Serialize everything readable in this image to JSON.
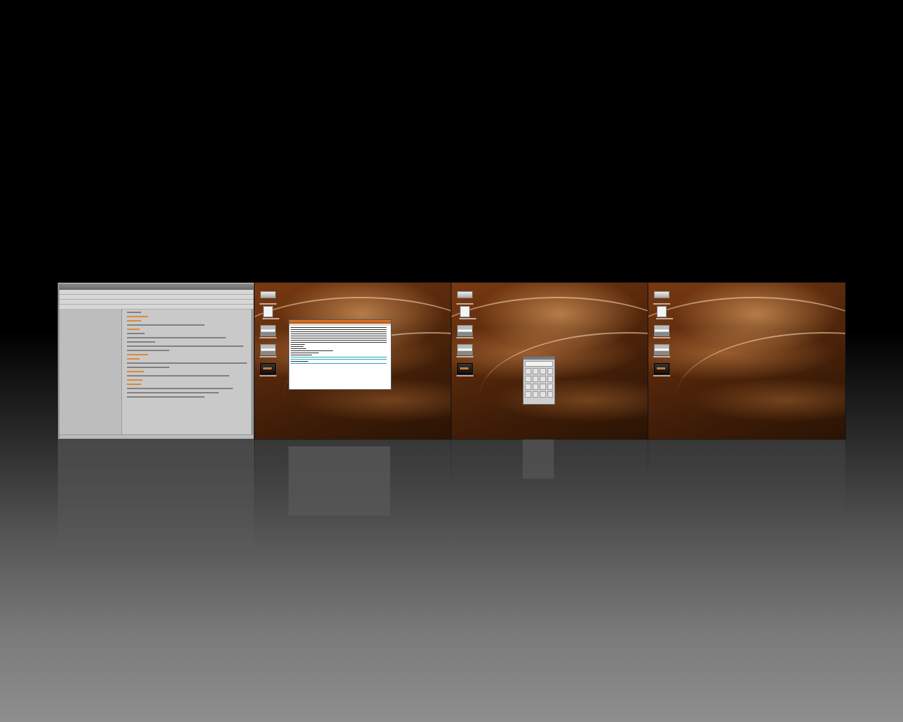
{
  "desktop": {
    "workspaces": [
      {
        "id": 1,
        "active": true,
        "window": "web-browser"
      },
      {
        "id": 2,
        "active": false,
        "window": "terminal"
      },
      {
        "id": 3,
        "active": false,
        "window": "calculator"
      },
      {
        "id": 4,
        "active": false,
        "window": ""
      }
    ],
    "desktop_icons": [
      "drive-icon",
      "document-icon",
      "screenshot-icon",
      "screenshot-icon",
      "terminal-thumbnail-icon"
    ],
    "colors": {
      "wallpaper": "#5a2a0c",
      "accent": "#d98b3a",
      "terminal_title": "#e07a2a",
      "terminal_highlight": "#2aa3b8"
    }
  }
}
